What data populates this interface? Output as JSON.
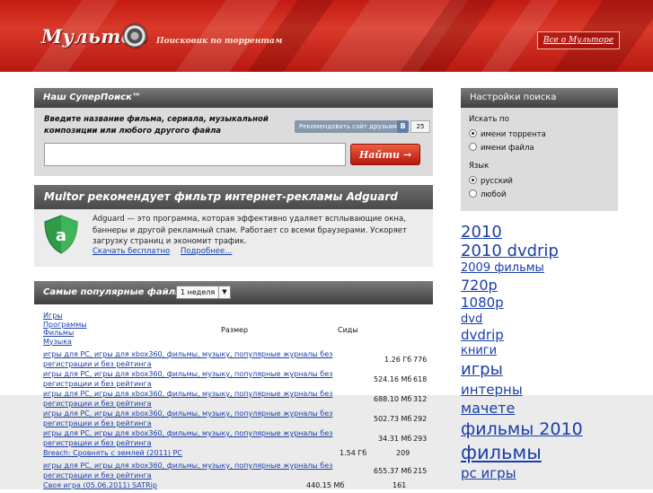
{
  "header": {
    "logo_text": "Мультор",
    "tagline": "Поисковик по торрентам",
    "about_link": "Все о Мульторе"
  },
  "super_search": {
    "title": "Наш СуперПоиск™",
    "description": "Введите название фильма, сериала, музыкальной композиции или любого другого файла",
    "recommend_label": "Рекомендовать сайт друзьям",
    "vk_icon": "vk-icon",
    "vk_count": "25",
    "input_value": "",
    "button_label": "Найти →"
  },
  "ad": {
    "title": "Multor рекомендует фильтр интернет-рекламы Adguard",
    "text": "Adguard — это программа, которая эффективно удаляет всплывающие окна, баннеры и другой рекламный спам. Работает со всеми браузерами. Ускоряет загрузку страниц и экономит трафик.",
    "download_link": "Скачать бесплатно",
    "more_link": "Подробнее...",
    "shield_color": "#2e9b47"
  },
  "popular": {
    "title": "Самые популярные файлы за",
    "period_selected": "1 неделя",
    "categories": [
      "Игры",
      "Программы",
      "Фильмы",
      "Музыка"
    ],
    "col_size": "Размер",
    "col_seeds": "Сиды",
    "rows": [
      {
        "title": "игры для PC, игры для xbox360, фильмы, музыку, популярные журналы без регистрации и без рейтинга",
        "size": "1.26 Гб",
        "seeds": "776"
      },
      {
        "title": "игры для PC, игры для xbox360, фильмы, музыку, популярные журналы без регистрации и без рейтинга",
        "size": "524.16 Мб",
        "seeds": "618"
      },
      {
        "title": "игры для PC, игры для xbox360, фильмы, музыку, популярные журналы без регистрации и без рейтинга",
        "size": "688.10 Мб",
        "seeds": "312"
      },
      {
        "title": "игры для PC, игры для xbox360, фильмы, музыку, популярные журналы без регистрации и без рейтинга",
        "size": "502.73 Мб",
        "seeds": "292"
      },
      {
        "title": "игры для PC, игры для xbox360, фильмы, музыку, популярные журналы без регистрации и без рейтинга",
        "size": "34.31 Мб",
        "seeds": "293"
      },
      {
        "title": "Breach: Сровнять с землей (2011) PC",
        "size": "1.54 Гб",
        "seeds": "209"
      },
      {
        "title": "игры для PC, игры для xbox360, фильмы, музыку, популярные журналы без регистрации и без рейтинга",
        "size": "655.37 Мб",
        "seeds": "215"
      },
      {
        "title": "Своя игра (05.06.2011) SATRip",
        "size": "440.15 Мб",
        "seeds": "161"
      }
    ]
  },
  "settings": {
    "title": "Настройки поиска",
    "search_by_label": "Искать по",
    "search_by_options": [
      "имени торрента",
      "имени файла"
    ],
    "search_by_selected": "имени торрента",
    "language_label": "Язык",
    "language_options": [
      "русский",
      "любой"
    ],
    "language_selected": "русский"
  },
  "tag_cloud": [
    {
      "text": "2010",
      "size": 18
    },
    {
      "text": "2010 dvdrip",
      "size": 18
    },
    {
      "text": "2009 фильмы",
      "size": 13
    },
    {
      "text": "720p",
      "size": 16
    },
    {
      "text": "1080p",
      "size": 15
    },
    {
      "text": "dvd",
      "size": 13
    },
    {
      "text": "dvdrip",
      "size": 15
    },
    {
      "text": "книги",
      "size": 13
    },
    {
      "text": "игры",
      "size": 18
    },
    {
      "text": "интерны",
      "size": 15
    },
    {
      "text": "мачете",
      "size": 16
    },
    {
      "text": "фильмы 2010",
      "size": 19
    },
    {
      "text": "фильмы",
      "size": 21
    },
    {
      "text": "pc игры",
      "size": 15
    }
  ],
  "colors": {
    "header_red": "#c41a12",
    "link_blue": "#1a3fa8",
    "panel_grey": "#dcdcdc",
    "button_red": "#d9381f"
  }
}
